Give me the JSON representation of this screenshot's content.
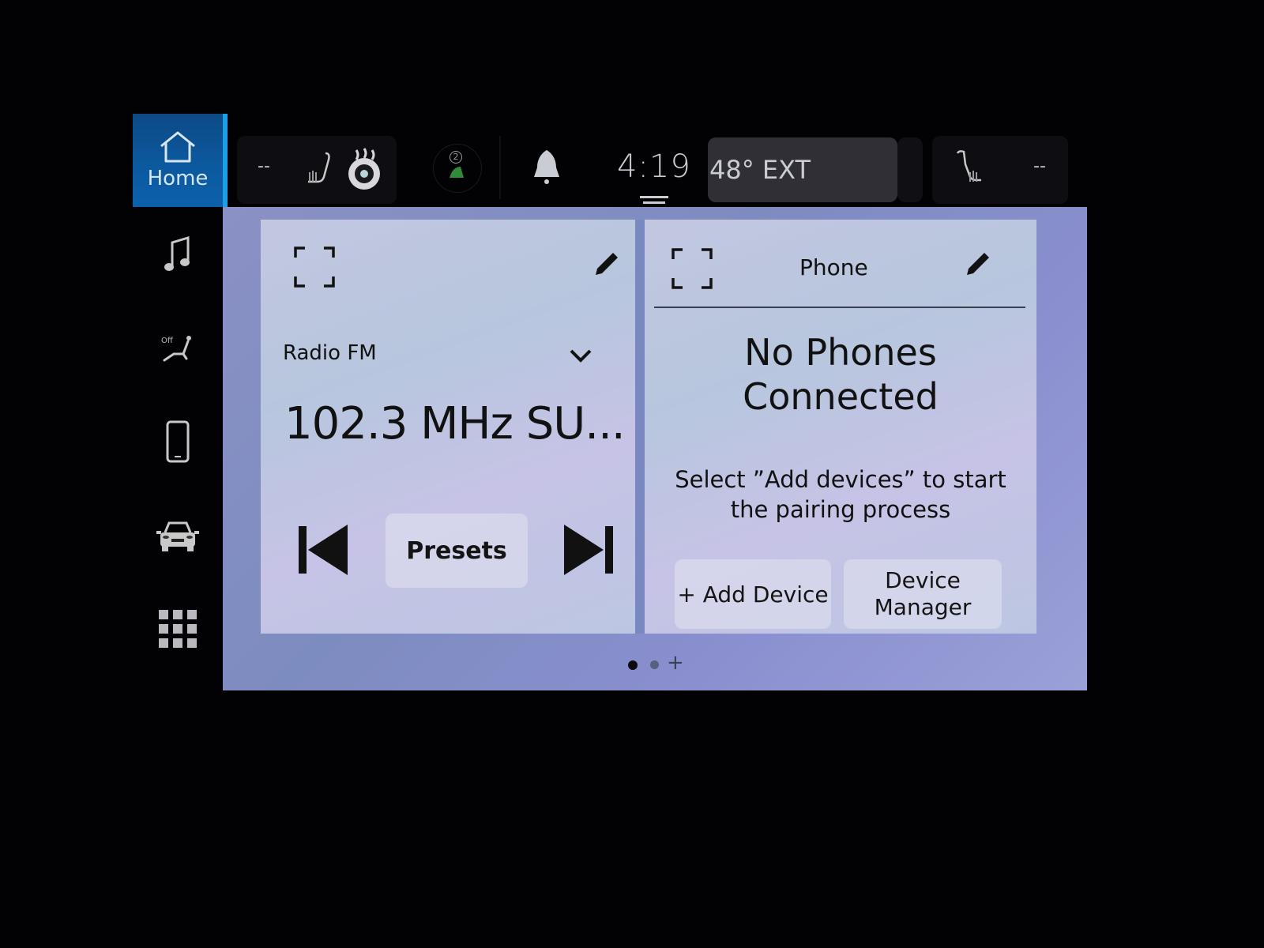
{
  "sidebar": {
    "home_label": "Home",
    "items": [
      {
        "name": "home",
        "icon": "home-icon",
        "active": true
      },
      {
        "name": "audio",
        "icon": "music-note-icon"
      },
      {
        "name": "seat-massage",
        "icon": "seat-massage-icon",
        "badge": "Off"
      },
      {
        "name": "phone",
        "icon": "phone-icon"
      },
      {
        "name": "vehicle",
        "icon": "car-icon"
      },
      {
        "name": "apps",
        "icon": "app-grid-icon"
      }
    ]
  },
  "status_bar": {
    "driver_temp": "--",
    "driver_seat_heat_icon": "heated-seat-icon",
    "heated_wheel_icon": "heated-steering-wheel-icon",
    "assist_badge_number": "2",
    "notification_icon": "bell-icon",
    "time": "4:19",
    "exterior_temp": "48° EXT",
    "passenger_seat_heat_icon": "heated-seat-icon",
    "passenger_temp": "--"
  },
  "radio_widget": {
    "source": "Radio FM",
    "station": "102.3 MHz SU...",
    "presets_label": "Presets",
    "icons": {
      "expand": "expand-icon",
      "edit": "pencil-icon",
      "dropdown": "chevron-down-icon",
      "prev": "skip-previous-icon",
      "next": "skip-next-icon"
    }
  },
  "phone_widget": {
    "title": "Phone",
    "status_line1": "No Phones",
    "status_line2": "Connected",
    "hint_line1": "Select ”Add devices” to start",
    "hint_line2": "the pairing process",
    "add_device_label": "+ Add Device",
    "device_manager_line1": "Device",
    "device_manager_line2": "Manager"
  },
  "pager": {
    "pages": 2,
    "current": 1,
    "add_symbol": "+"
  },
  "colors": {
    "accent": "#1ba0e6",
    "home_tile": "#0b5aa0",
    "assist_green": "#2f8a3a"
  }
}
